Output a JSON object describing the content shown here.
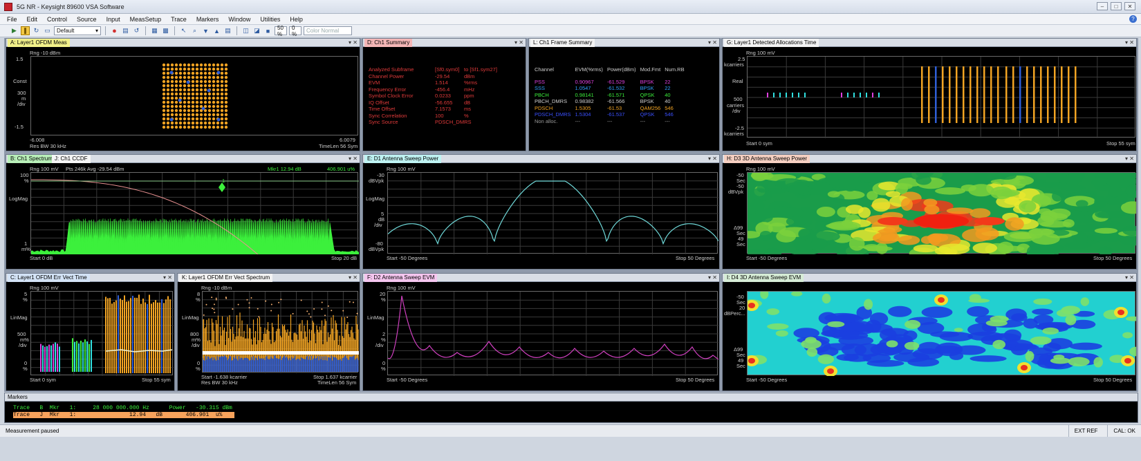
{
  "window": {
    "title": "5G NR - Keysight 89600 VSA Software"
  },
  "menu": [
    "File",
    "Edit",
    "Control",
    "Source",
    "Input",
    "MeasSetup",
    "Trace",
    "Markers",
    "Window",
    "Utilities",
    "Help"
  ],
  "toolbar": {
    "layout": "Default",
    "pct1": "50 %",
    "pct2": "0 %",
    "color_mode": "Color Normal"
  },
  "colors": {
    "trace_green": "#3cf03c",
    "orange": "#f2a423",
    "blue": "#2f5fd8",
    "cyan": "#30e0e0",
    "magenta": "#e040e0",
    "summary_red": "#e03a3a"
  },
  "panels": {
    "A": {
      "tab": "A: Layer1 OFDM Meas",
      "rng": "Rng -10 dBm",
      "y_top": "1.5",
      "y_bot": "-1.5",
      "ylabel1": "Const",
      "ylabel2": "300",
      "ylabel3": "m",
      "ylabel4": "/div",
      "x_left": "-6.008",
      "x_right": "6.0079",
      "res_bw": "Res BW 30 kHz",
      "timelen": "TimeLen 56 Sym"
    },
    "D": {
      "tab": "D: Ch1 Summary",
      "rows": [
        {
          "name": "Analyzed  Subframe",
          "value": "[Sf0.sym0]",
          "unit": "to  [Sf1.sym27]"
        },
        {
          "name": "Channel  Power",
          "value": "-29.54",
          "unit": "dBm"
        },
        {
          "name": "EVM",
          "value": "1.514",
          "unit": "%rms"
        },
        {
          "name": "Frequency  Error",
          "value": "-456.4",
          "unit": "mHz"
        },
        {
          "name": "Symbol  Clock  Error",
          "value": "0.0233",
          "unit": "ppm"
        },
        {
          "name": "IQ  Offset",
          "value": "-56.655",
          "unit": "dB"
        },
        {
          "name": "Time  Offset",
          "value": "7.1573",
          "unit": "ms"
        },
        {
          "name": "Sync  Correlation",
          "value": "100",
          "unit": "%"
        },
        {
          "name": "Sync  Source",
          "value": "PDSCH_DMRS",
          "unit": ""
        }
      ]
    },
    "L": {
      "tab": "L: Ch1 Frame Summary",
      "headers": [
        "Channel",
        "EVM(%rms)",
        "Power(dBm)",
        "Mod.Fmt",
        "Num.RB"
      ],
      "rows": [
        {
          "channel": "PSS",
          "evm": "0.90967",
          "power": "-61.529",
          "mod": "BPSK",
          "rb": "22",
          "color": "#e040e0"
        },
        {
          "channel": "SSS",
          "evm": "1.0547",
          "power": "-61.532",
          "mod": "BPSK",
          "rb": "22",
          "color": "#30a0ff"
        },
        {
          "channel": "PBCH",
          "evm": "0.98141",
          "power": "-61.571",
          "mod": "QPSK",
          "rb": "40",
          "color": "#3cf03c"
        },
        {
          "channel": "PBCH_DMRS",
          "evm": "0.98382",
          "power": "-61.566",
          "mod": "BPSK",
          "rb": "40",
          "color": "#cfcfcf"
        },
        {
          "channel": "PDSCH",
          "evm": "1.5305",
          "power": "-61.53",
          "mod": "QAM256",
          "rb": "546",
          "color": "#f2a423"
        },
        {
          "channel": "PDSCH_DMRS",
          "evm": "1.5304",
          "power": "-61.537",
          "mod": "QPSK",
          "rb": "546",
          "color": "#3a50ff"
        },
        {
          "channel": "Non alloc.",
          "evm": "---",
          "power": "---",
          "mod": "---",
          "rb": "---",
          "color": "#9a9a9a"
        }
      ]
    },
    "G": {
      "tab": "G: Layer1 Detected Allocations Time",
      "rng": "Rng 100 mV",
      "y1": "2.5",
      "y1u": "kcarriers",
      "y2": "Real",
      "y3": "500",
      "y3u": "carriers",
      "y3d": "/div",
      "y4": "-2.5",
      "y4u": "kcarriers",
      "start": "Start 0  sym",
      "stop": "Stop 55  sym"
    },
    "B": {
      "tab1": "B: Ch1 Spectrum",
      "tab2": "J: Ch1 CCDF",
      "rng": "Rng 100 mV",
      "pts": "Pts 246k Avg -29.54 dBm",
      "mkr": "Mkr1  12.94  dB",
      "mkr_val": "406.901  u%",
      "y1": "100",
      "y1u": "%",
      "y2": "LogMag",
      "y3": "1",
      "y3u": "m%",
      "start": "Start 0  dB",
      "stop": "Stop 20  dB",
      "marker_num": "1"
    },
    "E": {
      "tab": "E: D1 Antenna Sweep Power",
      "rng": "Rng 100 mV",
      "y1": "-30",
      "y1u": "dBVpk",
      "y2": "LogMag",
      "y3": "5",
      "y3u": "dB",
      "y3d": "/div",
      "y4": "-80",
      "y4u": "dBVpk",
      "start": "Start -50  Degrees",
      "stop": "Stop 50  Degrees"
    },
    "H": {
      "tab": "H: D3 3D Antenna Sweep Power",
      "rng": "Rng 100 mV",
      "y1": "-50",
      "y1u": "Sec",
      "y2": "-50",
      "y2u": "dBVpk",
      "y3": "Δ99",
      "y3u": "Sec",
      "y4": "49",
      "y4u": "Sec",
      "start": "Start -50  Degrees",
      "stop": "Stop 50  Degrees"
    },
    "C": {
      "tab": "C: Layer1 OFDM Err Vect Time",
      "rng": "Rng 100 mV",
      "y1": "5",
      "y1u": "%",
      "y2": "LinMag",
      "y3": "500",
      "y3u": "m%",
      "y3d": "/div",
      "y4": "0",
      "y4u": "%",
      "start": "Start 0  sym",
      "stop": "Stop 55  sym"
    },
    "K": {
      "tab": "K: Layer1 OFDM Err Vect Spectrum",
      "rng": "Rng -10 dBm",
      "y1": "8",
      "y1u": "%",
      "y2": "LinMag",
      "y3": "800",
      "y3u": "m%",
      "y3d": "/div",
      "y4": "0",
      "y4u": "%",
      "start": "Start -1.638  kcarrier",
      "stop": "Stop 1.637  kcarrier",
      "res_bw": "Res BW 30 kHz",
      "timelen": "TimeLen 56 Sym"
    },
    "F": {
      "tab": "F: D2 Antenna Sweep EVM",
      "rng": "Rng 100 mV",
      "y1": "20",
      "y1u": "%",
      "y2": "LinMag",
      "y3": "2",
      "y3u": "%",
      "y3d": "/div",
      "y4": "0",
      "y4u": "%",
      "start": "Start -50  Degrees",
      "stop": "Stop 50  Degrees"
    },
    "I": {
      "tab": "I: D4 3D Antenna Sweep EVM",
      "y1": "-50",
      "y1u": "Sec",
      "y2": "20",
      "y2u": "dBPerc...",
      "y3": "Δ99",
      "y3u": "Sec",
      "y4": "49",
      "y4u": "Sec",
      "start": "Start -50  Degrees",
      "stop": "Stop 50  Degrees"
    }
  },
  "markers": {
    "title": "Markers",
    "row1": "Trace   B  Mkr   1:     28 000 000.000 Hz      Power   -30.315 dBm",
    "row2": "Trace   J  Mkr   1:                12.94   dB       406.901  u%"
  },
  "status": {
    "left": "Measurement paused",
    "ext_ref": "EXT REF",
    "cal": "CAL: OK"
  }
}
